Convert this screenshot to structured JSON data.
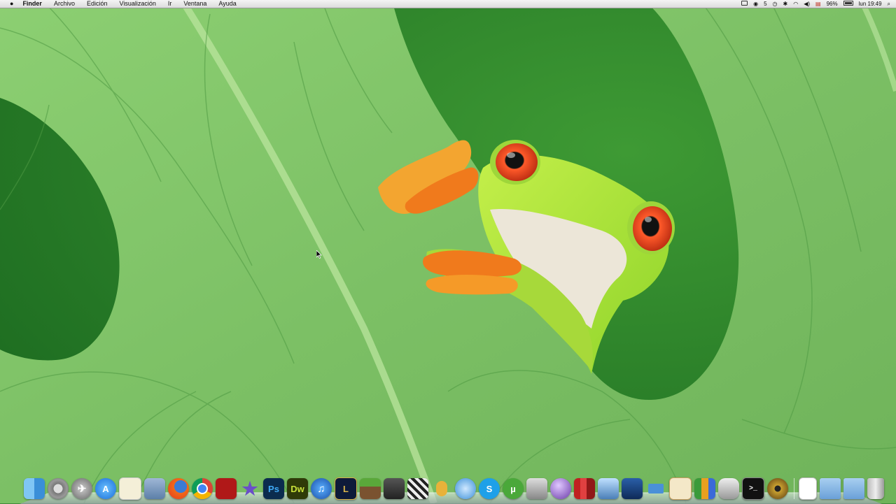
{
  "menubar": {
    "apple_icon": "apple-logo-icon",
    "app_name": "Finder",
    "menus": [
      "Archivo",
      "Edición",
      "Visualización",
      "Ir",
      "Ventana",
      "Ayuda"
    ],
    "status": {
      "wifi_icon": "wifi-icon",
      "volume_icon": "volume-icon",
      "battery_percent": "96%",
      "clock": "lun 19:49",
      "count": "5"
    }
  },
  "dock": {
    "apps": [
      {
        "name": "Finder",
        "icon": "finder-icon",
        "label": ""
      },
      {
        "name": "Preferencias del Sistema",
        "icon": "system-preferences-icon",
        "label": ""
      },
      {
        "name": "Launchpad",
        "icon": "launchpad-icon",
        "label": ""
      },
      {
        "name": "App Store",
        "icon": "app-store-icon",
        "label": "A"
      },
      {
        "name": "Notas",
        "icon": "notes-icon",
        "label": ""
      },
      {
        "name": "Vista Previa",
        "icon": "preview-icon",
        "label": ""
      },
      {
        "name": "Firefox",
        "icon": "firefox-icon",
        "label": ""
      },
      {
        "name": "Chrome",
        "icon": "chrome-icon",
        "label": ""
      },
      {
        "name": "Photo Booth",
        "icon": "photo-booth-icon",
        "label": ""
      },
      {
        "name": "iMovie",
        "icon": "imovie-star-icon",
        "label": "★"
      },
      {
        "name": "Photoshop",
        "icon": "photoshop-icon",
        "label": "Ps"
      },
      {
        "name": "Dreamweaver",
        "icon": "dreamweaver-icon",
        "label": "Dw"
      },
      {
        "name": "iTunes",
        "icon": "itunes-icon",
        "label": "♫"
      },
      {
        "name": "League of Legends",
        "icon": "league-icon",
        "label": "L"
      },
      {
        "name": "Minecraft",
        "icon": "minecraft-icon",
        "label": ""
      },
      {
        "name": "Steam",
        "icon": "steam-icon",
        "label": ""
      },
      {
        "name": "Final Cut",
        "icon": "clapperboard-icon",
        "label": ""
      },
      {
        "name": "Piña",
        "icon": "pineapple-icon",
        "label": ""
      },
      {
        "name": "Sincronizar",
        "icon": "sync-icon",
        "label": ""
      },
      {
        "name": "Skype",
        "icon": "skype-icon",
        "label": "S"
      },
      {
        "name": "uTorrent",
        "icon": "utorrent-icon",
        "label": "µ"
      },
      {
        "name": "Captura",
        "icon": "screen-capture-icon",
        "label": ""
      },
      {
        "name": "Orbe",
        "icon": "sphere-icon",
        "label": ""
      },
      {
        "name": "Libros",
        "icon": "books-icon",
        "label": ""
      },
      {
        "name": "Monitor",
        "icon": "monitor-icon",
        "label": ""
      },
      {
        "name": "Xcode",
        "icon": "xcode-icon",
        "label": ""
      },
      {
        "name": "Keynote",
        "icon": "keynote-icon",
        "label": ""
      },
      {
        "name": "Pages",
        "icon": "pages-icon",
        "label": ""
      },
      {
        "name": "Numbers",
        "icon": "numbers-icon",
        "label": ""
      },
      {
        "name": "Utilidad de Discos",
        "icon": "disk-utility-icon",
        "label": ""
      },
      {
        "name": "Terminal",
        "icon": "terminal-icon",
        "label": ">_"
      },
      {
        "name": "Disco",
        "icon": "disc-icon",
        "label": ""
      }
    ],
    "right": [
      {
        "name": "Documento",
        "icon": "document-icon"
      },
      {
        "name": "Carpeta",
        "icon": "folder-icon"
      },
      {
        "name": "Descargas",
        "icon": "downloads-folder-icon"
      },
      {
        "name": "Papelera",
        "icon": "trash-icon"
      }
    ]
  },
  "colors": {
    "leaf": "#7fbf6a",
    "leaf_dark": "#2e7a2b",
    "frog": "#a8e030",
    "frog_eye": "#e2401a",
    "frog_feet": "#f07a1c"
  }
}
